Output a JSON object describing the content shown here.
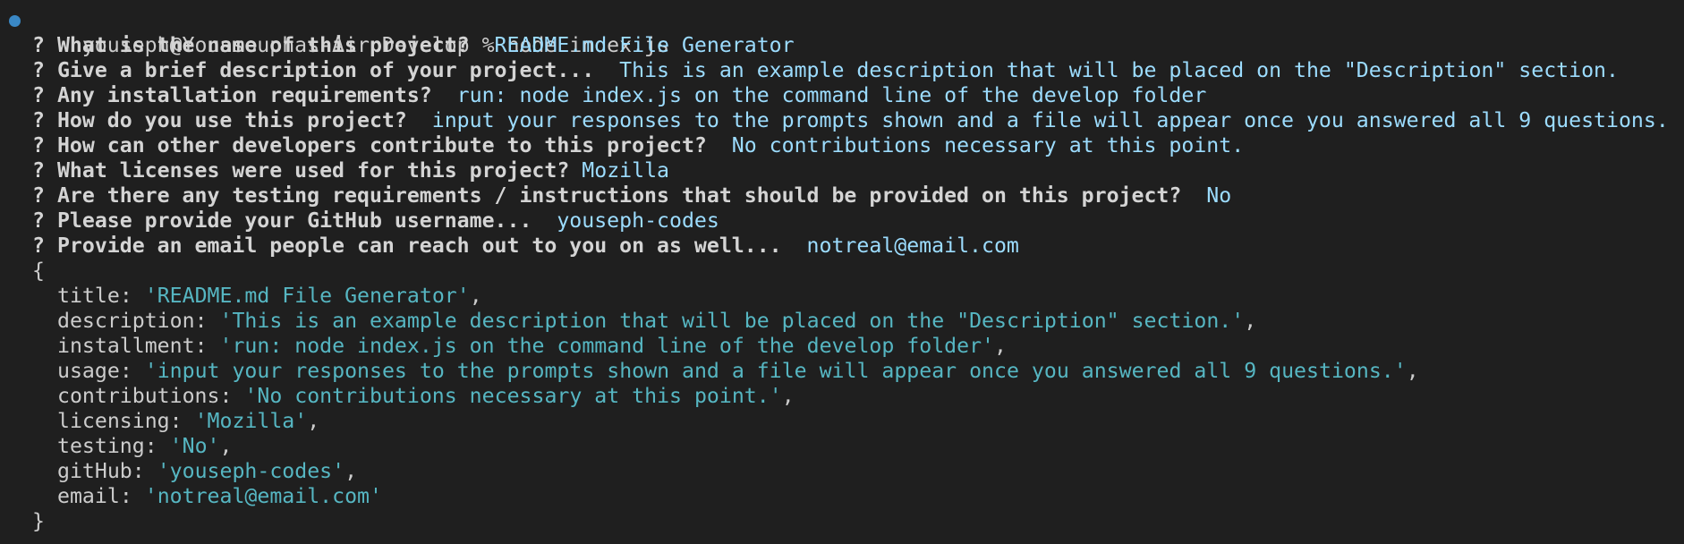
{
  "colors": {
    "background": "#1f1f1f",
    "status_dot": "#3a88c5",
    "answer": "#9cdcfe",
    "string": "#56b6c2",
    "text": "#cccccc"
  },
  "terminal": {
    "command_line": "youseph@Youssouphas-Air Develop % node index.js",
    "question_mark": "?",
    "qa": [
      {
        "question": "What is the name of this project?",
        "answer": "README.md File Generator"
      },
      {
        "question": "Give a brief description of your project...",
        "answer": "This is an example description that will be placed on the \"Description\" section."
      },
      {
        "question": "Any installation requirements?",
        "answer": "run: node index.js on the command line of the develop folder"
      },
      {
        "question": "How do you use this project?",
        "answer": "input your responses to the prompts shown and a file will appear once you answered all 9 questions."
      },
      {
        "question": "How can other developers contribute to this project?",
        "answer": "No contributions necessary at this point."
      },
      {
        "question": "What licenses were used for this project?",
        "answer": "Mozilla"
      },
      {
        "question": "Are there any testing requirements / instructions that should be provided on this project?",
        "answer": "No"
      },
      {
        "question": "Please provide your GitHub username...",
        "answer": "youseph-codes"
      },
      {
        "question": "Provide an email people can reach out to you on as well...",
        "answer": "notreal@email.com"
      }
    ],
    "object_open": "{",
    "object_close": "}",
    "object_entries": [
      {
        "key": "title",
        "value": "'README.md File Generator'",
        "sep": ","
      },
      {
        "key": "description",
        "value": "'This is an example description that will be placed on the \"Description\" section.'",
        "sep": ","
      },
      {
        "key": "installment",
        "value": "'run: node index.js on the command line of the develop folder'",
        "sep": ","
      },
      {
        "key": "usage",
        "value": "'input your responses to the prompts shown and a file will appear once you answered all 9 questions.'",
        "sep": ","
      },
      {
        "key": "contributions",
        "value": "'No contributions necessary at this point.'",
        "sep": ","
      },
      {
        "key": "licensing",
        "value": "'Mozilla'",
        "sep": ","
      },
      {
        "key": "testing",
        "value": "'No'",
        "sep": ","
      },
      {
        "key": "gitHub",
        "value": "'youseph-codes'",
        "sep": ","
      },
      {
        "key": "email",
        "value": "'notreal@email.com'",
        "sep": ""
      }
    ]
  }
}
